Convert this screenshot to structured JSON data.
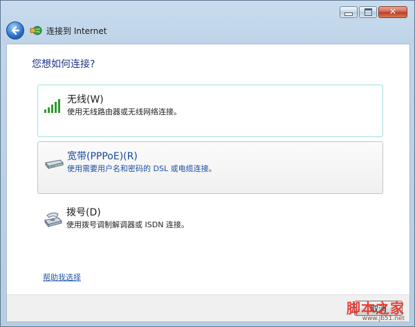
{
  "window": {
    "title": "连接到 Internet",
    "close_glyph": "✕"
  },
  "page": {
    "heading": "您想如何连接?"
  },
  "options": [
    {
      "title": "无线(W)",
      "description": "使用无线路由器或无线网络连接。",
      "icon": "wireless-signal-icon"
    },
    {
      "title": "宽带(PPPoE)(R)",
      "description": "使用需要用户名和密码的 DSL 或电缆连接。",
      "icon": "broadband-modem-icon"
    },
    {
      "title": "拨号(D)",
      "description": "使用拨号调制解调器或 ISDN 连接。",
      "icon": "dialup-phone-modem-icon"
    }
  ],
  "help_link": "帮助我选择",
  "cancel_label": "取消",
  "watermark": {
    "text": "脚本之家",
    "url": "www.jb51.net"
  },
  "colors": {
    "heading": "#1e3287",
    "link": "#2457a7",
    "selected_border": "#a6e3e0",
    "watermark": "#e5261b"
  }
}
